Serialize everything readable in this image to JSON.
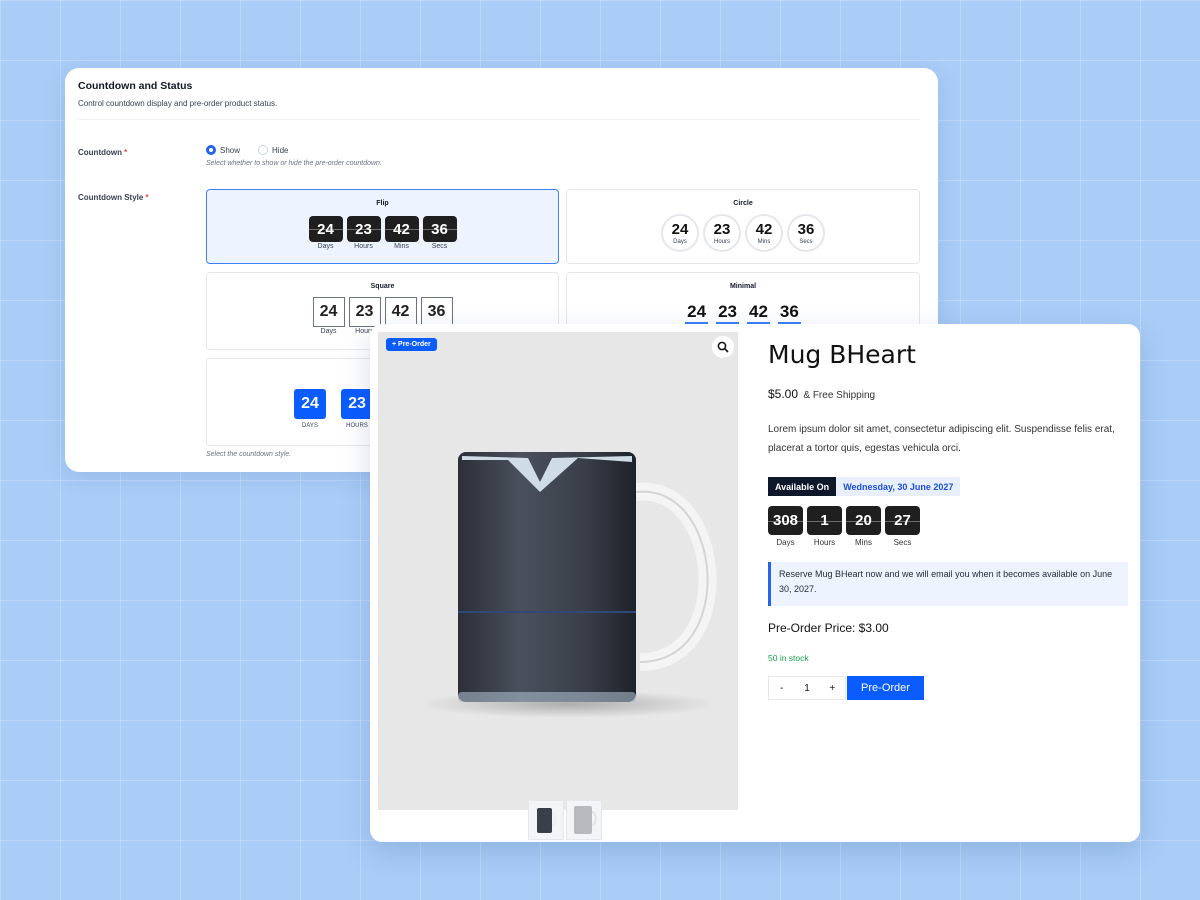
{
  "settings": {
    "title": "Countdown and Status",
    "description": "Control countdown display and pre-order product status.",
    "countdown_label": "Countdown",
    "required_mark": "*",
    "show_label": "Show",
    "hide_label": "Hide",
    "countdown_hint": "Select whether to show or hide the pre-order countdown.",
    "style_label": "Countdown Style",
    "style_hint": "Select the countdown style.",
    "selected_visibility": "Show",
    "selected_style": "Flip",
    "styles": {
      "flip": {
        "label": "Flip",
        "values": [
          "24",
          "23",
          "42",
          "36"
        ],
        "units": [
          "Days",
          "Hours",
          "Mins",
          "Secs"
        ]
      },
      "circle": {
        "label": "Circle",
        "values": [
          "24",
          "23",
          "42",
          "36"
        ],
        "units": [
          "Days",
          "Hours",
          "Mins",
          "Secs"
        ]
      },
      "square": {
        "label": "Square",
        "values": [
          "24",
          "23",
          "42",
          "36"
        ],
        "units": [
          "Days",
          "Hours"
        ]
      },
      "minimal": {
        "label": "Minimal",
        "values": [
          "24",
          "23",
          "42",
          "36"
        ]
      },
      "boxed": {
        "values": [
          "24",
          "23"
        ],
        "units": [
          "DAYS",
          "HOURS"
        ]
      }
    }
  },
  "product": {
    "badge": "+ Pre-Order",
    "title": "Mug BHeart",
    "price": "$5.00",
    "shipping": "& Free Shipping",
    "description": "Lorem ipsum dolor sit amet, consectetur adipiscing elit. Suspendisse felis erat, placerat a tortor quis, egestas vehicula orci.",
    "available_label": "Available On",
    "available_date": "Wednesday, 30 June 2027",
    "countdown": {
      "values": [
        "308",
        "1",
        "20",
        "27"
      ],
      "units": [
        "Days",
        "Hours",
        "Mins",
        "Secs"
      ]
    },
    "notice": "Reserve Mug BHeart now and we will email you when it becomes available on June 30, 2027.",
    "preorder_price": "Pre-Order Price: $3.00",
    "stock": "50 in stock",
    "qty_minus": "-",
    "qty_value": "1",
    "qty_plus": "+",
    "button": "Pre-Order"
  },
  "colors": {
    "accent": "#0b5cff",
    "background": "#a9cdf7",
    "flip_box": "#1f1f1f",
    "stock_green": "#16a34a"
  },
  "icons": {
    "zoom": "magnifier-icon"
  }
}
